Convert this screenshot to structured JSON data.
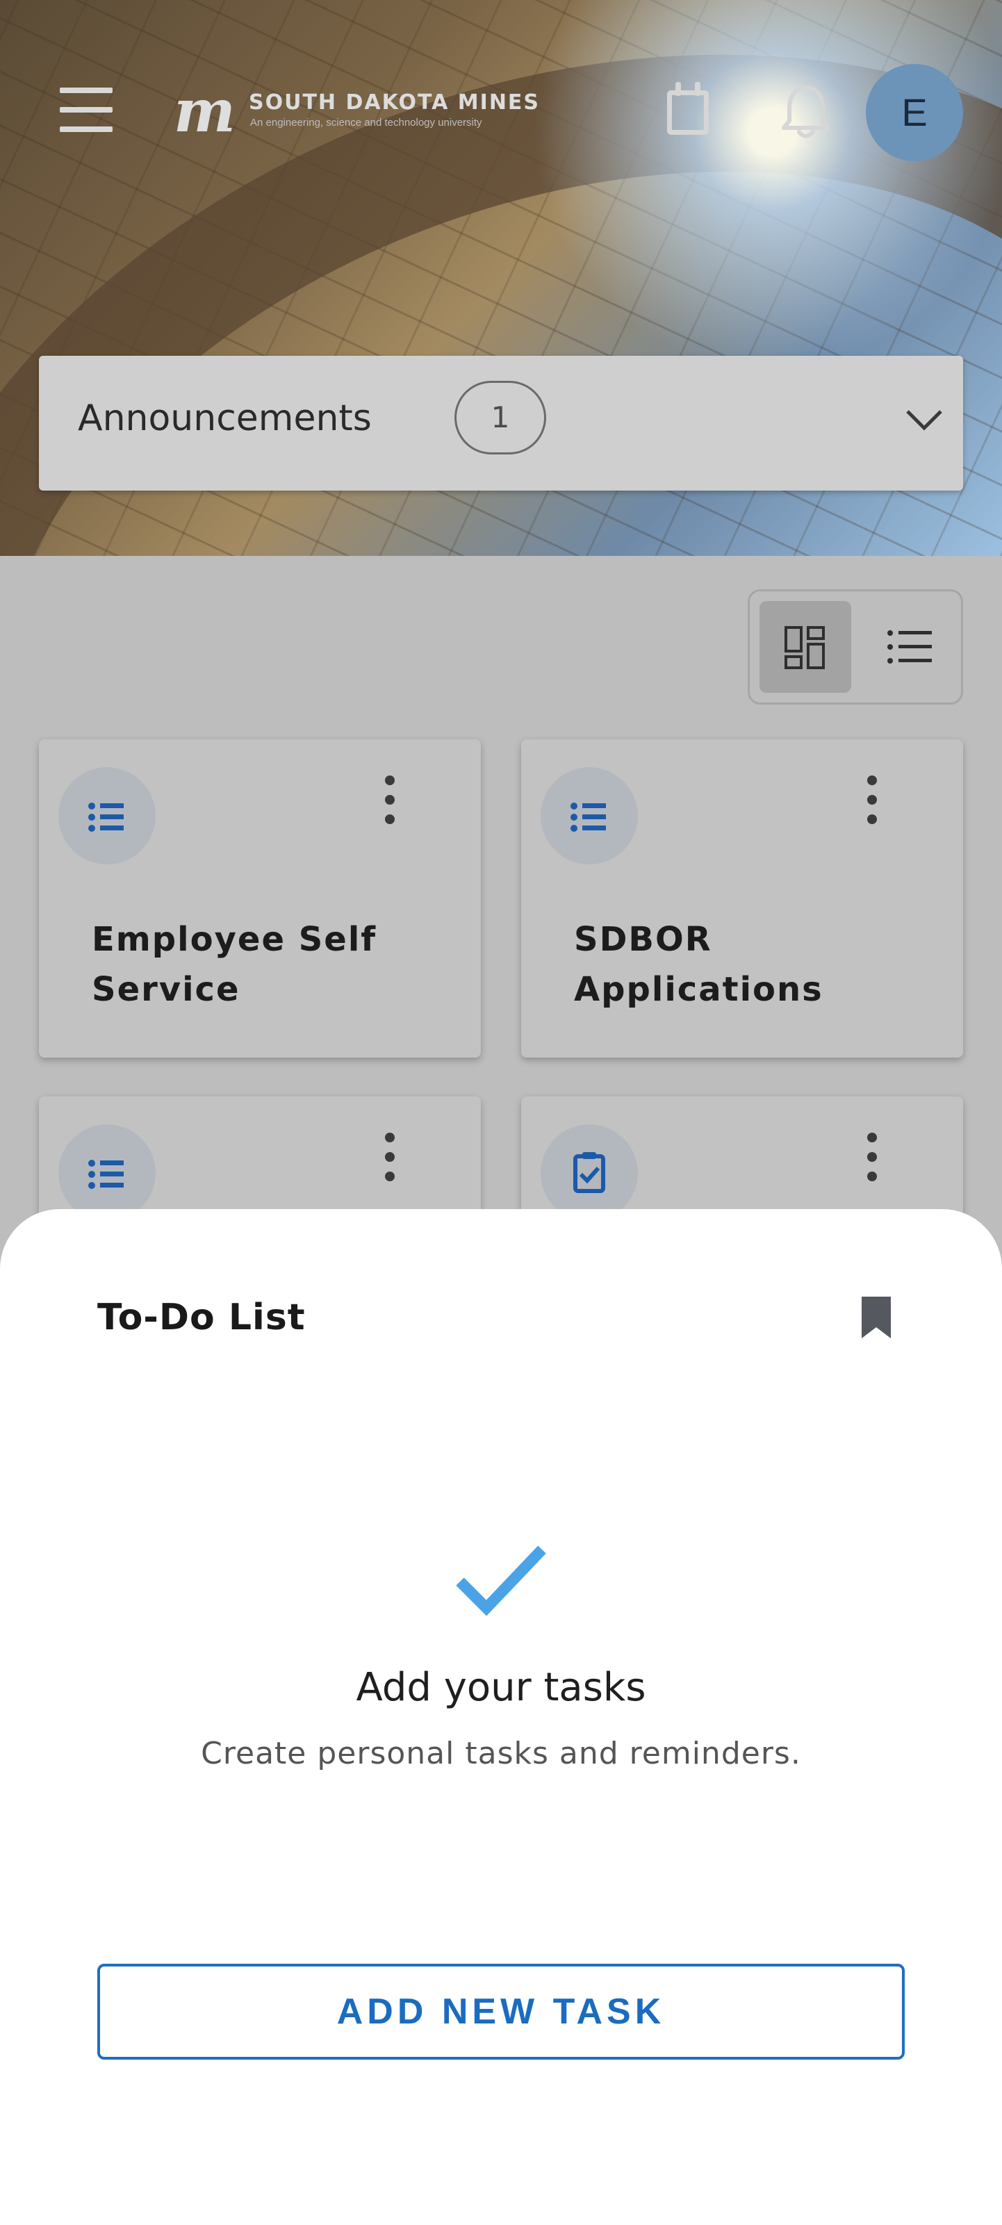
{
  "header": {
    "logo_name": "SOUTH DAKOTA MINES",
    "logo_tagline": "An engineering, science and technology university",
    "avatar_initial": "E"
  },
  "announcements": {
    "label": "Announcements",
    "count": "1"
  },
  "cards": [
    {
      "title": "Employee Self Service",
      "icon": "list-icon"
    },
    {
      "title": "SDBOR Applications",
      "icon": "list-icon"
    },
    {
      "title": "",
      "icon": "list-icon"
    },
    {
      "title": "",
      "icon": "clipboard-check-icon"
    }
  ],
  "todo": {
    "title": "To-Do List",
    "empty_title": "Add your tasks",
    "empty_subtitle": "Create personal tasks and reminders.",
    "add_button": "ADD NEW TASK"
  },
  "colors": {
    "accent": "#1a6cc0",
    "check": "#4aa3e6",
    "avatar": "#6c93b8"
  }
}
